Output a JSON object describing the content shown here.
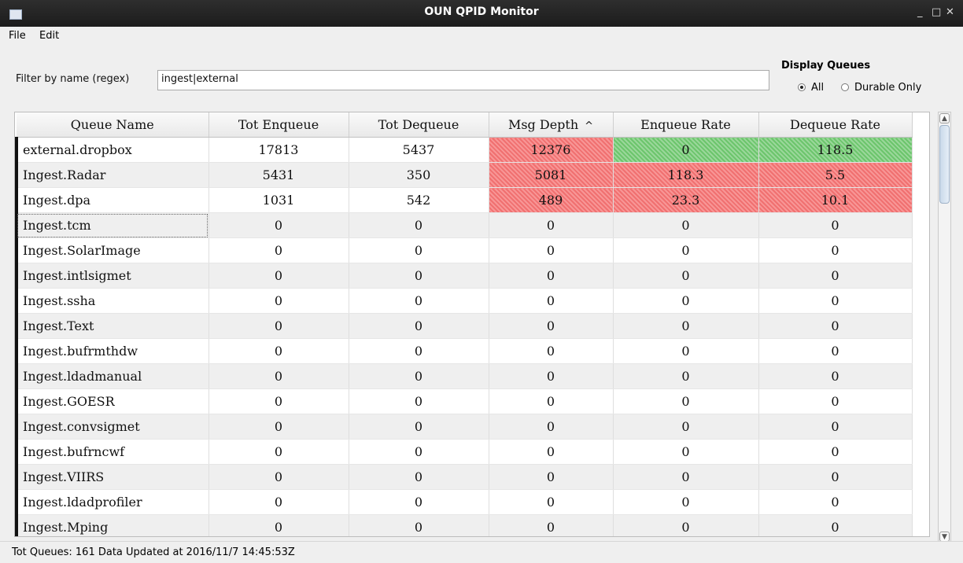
{
  "window": {
    "title": "OUN QPID Monitor",
    "min_label": "_",
    "max_label": "□",
    "close_label": "✕"
  },
  "menu": [
    {
      "label": "File"
    },
    {
      "label": "Edit"
    }
  ],
  "filter": {
    "label": "Filter by name (regex)",
    "value": "ingest|external"
  },
  "display_queues": {
    "title": "Display Queues",
    "options": [
      {
        "label": "All",
        "selected": true
      },
      {
        "label": "Durable Only",
        "selected": false
      }
    ]
  },
  "table": {
    "columns": [
      "Queue Name",
      "Tot Enqueue",
      "Tot Dequeue",
      "Msg Depth",
      "Enqueue Rate",
      "Dequeue Rate"
    ],
    "sort_indicator": "^",
    "rows": [
      {
        "name": "external.dropbox",
        "tot_enqueue": "17813",
        "tot_dequeue": "5437",
        "msg_depth": "12376",
        "enqueue_rate": "0",
        "dequeue_rate": "118.5",
        "depth_status": "red",
        "enq_status": "green",
        "deq_status": "green"
      },
      {
        "name": "Ingest.Radar",
        "tot_enqueue": "5431",
        "tot_dequeue": "350",
        "msg_depth": "5081",
        "enqueue_rate": "118.3",
        "dequeue_rate": "5.5",
        "depth_status": "red",
        "enq_status": "red",
        "deq_status": "red"
      },
      {
        "name": "Ingest.dpa",
        "tot_enqueue": "1031",
        "tot_dequeue": "542",
        "msg_depth": "489",
        "enqueue_rate": "23.3",
        "dequeue_rate": "10.1",
        "depth_status": "red",
        "enq_status": "red",
        "deq_status": "red"
      },
      {
        "name": "Ingest.tcm",
        "tot_enqueue": "0",
        "tot_dequeue": "0",
        "msg_depth": "0",
        "enqueue_rate": "0",
        "dequeue_rate": "0"
      },
      {
        "name": "Ingest.SolarImage",
        "tot_enqueue": "0",
        "tot_dequeue": "0",
        "msg_depth": "0",
        "enqueue_rate": "0",
        "dequeue_rate": "0"
      },
      {
        "name": "Ingest.intlsigmet",
        "tot_enqueue": "0",
        "tot_dequeue": "0",
        "msg_depth": "0",
        "enqueue_rate": "0",
        "dequeue_rate": "0"
      },
      {
        "name": "Ingest.ssha",
        "tot_enqueue": "0",
        "tot_dequeue": "0",
        "msg_depth": "0",
        "enqueue_rate": "0",
        "dequeue_rate": "0"
      },
      {
        "name": "Ingest.Text",
        "tot_enqueue": "0",
        "tot_dequeue": "0",
        "msg_depth": "0",
        "enqueue_rate": "0",
        "dequeue_rate": "0"
      },
      {
        "name": "Ingest.bufrmthdw",
        "tot_enqueue": "0",
        "tot_dequeue": "0",
        "msg_depth": "0",
        "enqueue_rate": "0",
        "dequeue_rate": "0"
      },
      {
        "name": "Ingest.ldadmanual",
        "tot_enqueue": "0",
        "tot_dequeue": "0",
        "msg_depth": "0",
        "enqueue_rate": "0",
        "dequeue_rate": "0"
      },
      {
        "name": "Ingest.GOESR",
        "tot_enqueue": "0",
        "tot_dequeue": "0",
        "msg_depth": "0",
        "enqueue_rate": "0",
        "dequeue_rate": "0"
      },
      {
        "name": "Ingest.convsigmet",
        "tot_enqueue": "0",
        "tot_dequeue": "0",
        "msg_depth": "0",
        "enqueue_rate": "0",
        "dequeue_rate": "0"
      },
      {
        "name": "Ingest.bufrncwf",
        "tot_enqueue": "0",
        "tot_dequeue": "0",
        "msg_depth": "0",
        "enqueue_rate": "0",
        "dequeue_rate": "0"
      },
      {
        "name": "Ingest.VIIRS",
        "tot_enqueue": "0",
        "tot_dequeue": "0",
        "msg_depth": "0",
        "enqueue_rate": "0",
        "dequeue_rate": "0"
      },
      {
        "name": "Ingest.ldadprofiler",
        "tot_enqueue": "0",
        "tot_dequeue": "0",
        "msg_depth": "0",
        "enqueue_rate": "0",
        "dequeue_rate": "0"
      },
      {
        "name": "Ingest.Mping",
        "tot_enqueue": "0",
        "tot_dequeue": "0",
        "msg_depth": "0",
        "enqueue_rate": "0",
        "dequeue_rate": "0"
      }
    ]
  },
  "status": {
    "text": "Tot Queues: 161  Data Updated at 2016/11/7 14:45:53Z"
  },
  "colors": {
    "alert_red": "#f07070",
    "ok_green": "#6cc56c"
  }
}
